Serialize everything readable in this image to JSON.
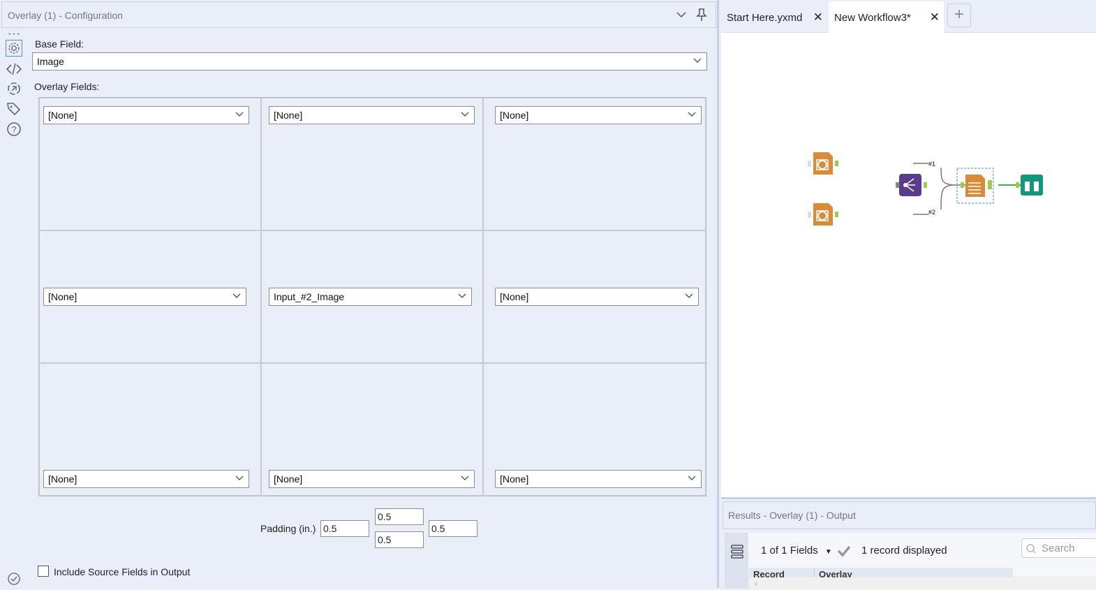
{
  "config": {
    "title": "Overlay (1) - Configuration",
    "base_field_label": "Base Field:",
    "base_field_value": "Image",
    "overlay_fields_label": "Overlay Fields:",
    "overlay_fields": [
      "[None]",
      "[None]",
      "[None]",
      "[None]",
      "Input_#2_Image",
      "[None]",
      "[None]",
      "[None]",
      "[None]"
    ],
    "padding_label": "Padding (in.)",
    "padding": {
      "left": "0.5",
      "top": "0.5",
      "bottom": "0.5",
      "right": "0.5"
    },
    "include_source_label": "Include Source Fields in Output",
    "include_source_checked": false
  },
  "tabs": [
    {
      "label": "Start Here.yxmd"
    },
    {
      "label": "New Workflow3*"
    }
  ],
  "canvas": {
    "conn1": "#1",
    "conn2": "#2"
  },
  "results": {
    "title": "Results - Overlay (1) - Output",
    "fields": "1 of 1 Fields",
    "records": "1 record displayed",
    "search_placeholder": "Search",
    "columns": [
      "Record",
      "Overlay"
    ]
  }
}
